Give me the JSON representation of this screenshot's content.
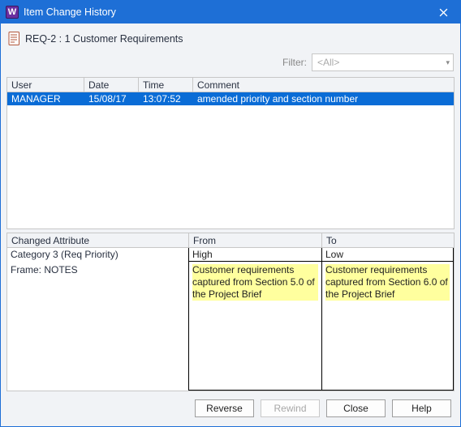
{
  "window": {
    "title": "Item Change History"
  },
  "header": {
    "item_label": "REQ-2 : 1 Customer Requirements"
  },
  "filter": {
    "label": "Filter:",
    "value": "<All>"
  },
  "history": {
    "columns": {
      "user": "User",
      "date": "Date",
      "time": "Time",
      "comment": "Comment"
    },
    "rows": [
      {
        "user": "MANAGER",
        "date": "15/08/17",
        "time": "13:07:52",
        "comment": "amended priority and section number"
      }
    ]
  },
  "detail": {
    "columns": {
      "attr": "Changed Attribute",
      "from": "From",
      "to": "To"
    },
    "rows": [
      {
        "attr": "Category 3 (Req Priority)",
        "from": "High",
        "to": "Low",
        "highlight": false
      },
      {
        "attr": "Frame: NOTES",
        "from": "Customer requirements captured from Section 5.0 of the Project Brief",
        "to": "Customer requirements captured from Section 6.0 of the Project Brief",
        "highlight": true
      }
    ]
  },
  "buttons": {
    "reverse": "Reverse",
    "rewind": "Rewind",
    "close": "Close",
    "help": "Help"
  }
}
